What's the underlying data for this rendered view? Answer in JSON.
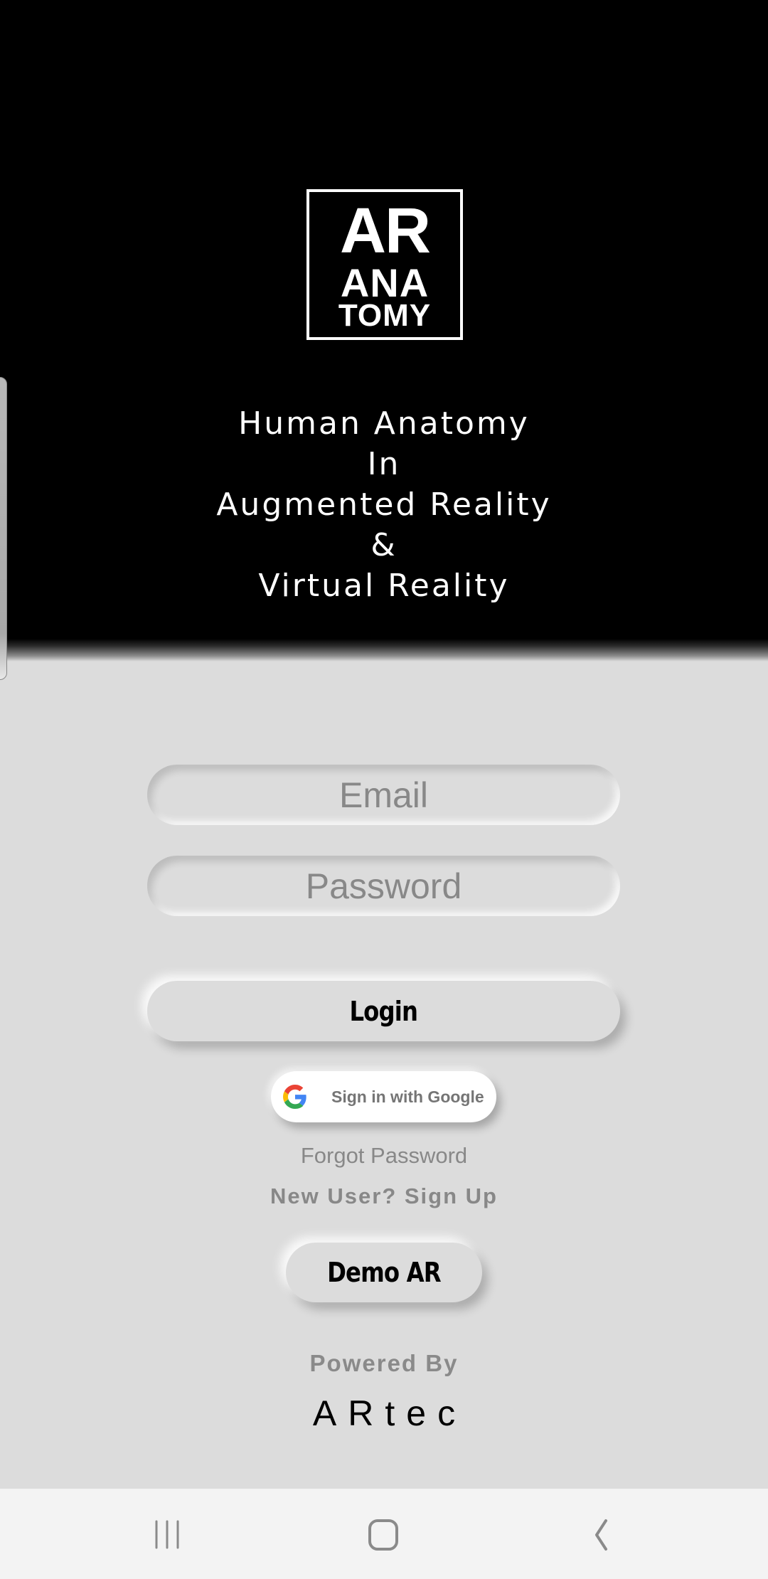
{
  "logo": {
    "line1": "AR",
    "line2": "ANA",
    "line3": "TOMY"
  },
  "tagline": {
    "lines": [
      "Human Anatomy",
      "In",
      "Augmented Reality",
      "&",
      "Virtual Reality"
    ]
  },
  "form": {
    "email": {
      "value": "",
      "placeholder": "Email"
    },
    "password": {
      "value": "",
      "placeholder": "Password"
    },
    "login_label": "Login",
    "google_label": "Sign in with Google",
    "forgot_label": "Forgot Password",
    "signup_label": "New User? Sign Up",
    "demo_label": "Demo AR"
  },
  "footer": {
    "powered_by": "Powered By",
    "brand": "ARtec"
  },
  "navbar": {
    "icons": [
      "recent-apps-icon",
      "home-icon",
      "back-icon"
    ]
  },
  "colors": {
    "header_bg": "#000000",
    "body_bg": "#dcdcdc",
    "placeholder": "#888888",
    "google_text": "#757575",
    "navbar_bg": "#f3f3f3"
  }
}
